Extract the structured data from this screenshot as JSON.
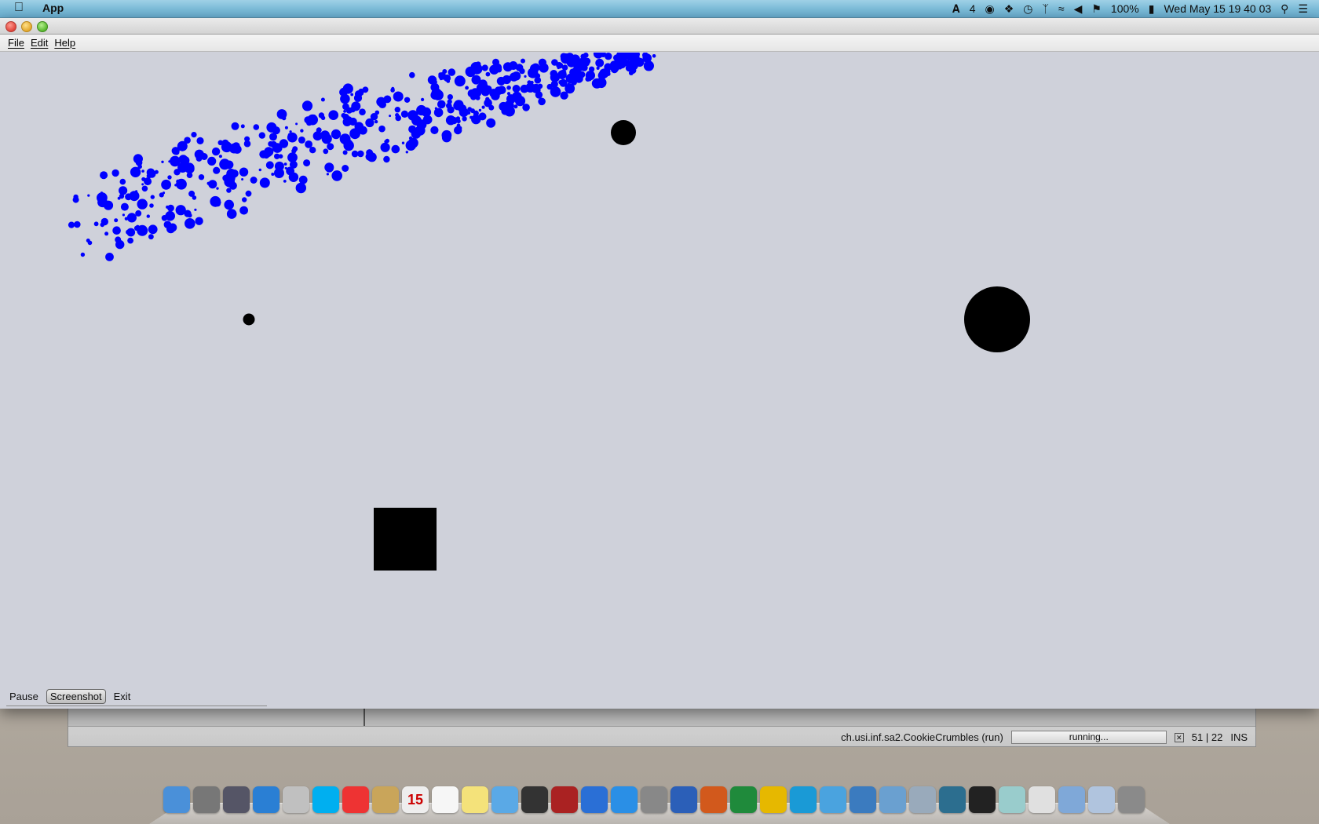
{
  "menubar": {
    "app_name": "App",
    "status_items": [
      "4",
      "100%",
      "Wed May 15  19 40 03"
    ]
  },
  "window": {
    "menu": [
      "File",
      "Edit",
      "Help"
    ],
    "controls": {
      "pause": "Pause",
      "screenshot": "Screenshot",
      "exit": "Exit"
    }
  },
  "scene": {
    "particle_color": "#0000ff",
    "object_color": "#000000",
    "background_color": "#cfd1da"
  },
  "ide": {
    "run_label": "ch.usi.inf.sa2.CookieCrumbles (run)",
    "progress": "running...",
    "position": "51 | 22",
    "mode": "INS"
  },
  "dock": {
    "icons": [
      "finder-icon",
      "launchpad-icon",
      "photo-icon",
      "safari-icon",
      "mail-icon",
      "skype-icon",
      "chrome-icon",
      "contacts-icon",
      "calendar-icon",
      "reminders-icon",
      "notes-icon",
      "messages-icon",
      "facetime-icon",
      "photobooth-icon",
      "itunes-icon",
      "appstore-icon",
      "preferences-icon",
      "word-icon",
      "powerpoint-icon",
      "excel-icon",
      "outlook-icon",
      "c-icon",
      "messenger-icon",
      "network-icon",
      "preview-icon",
      "cyberduck-icon",
      "sourcetree-icon",
      "activity-monitor-icon",
      "virtualbox-icon",
      "java-icon",
      "documents-icon",
      "downloads-icon",
      "trash-icon"
    ],
    "calendar_day": "15"
  }
}
